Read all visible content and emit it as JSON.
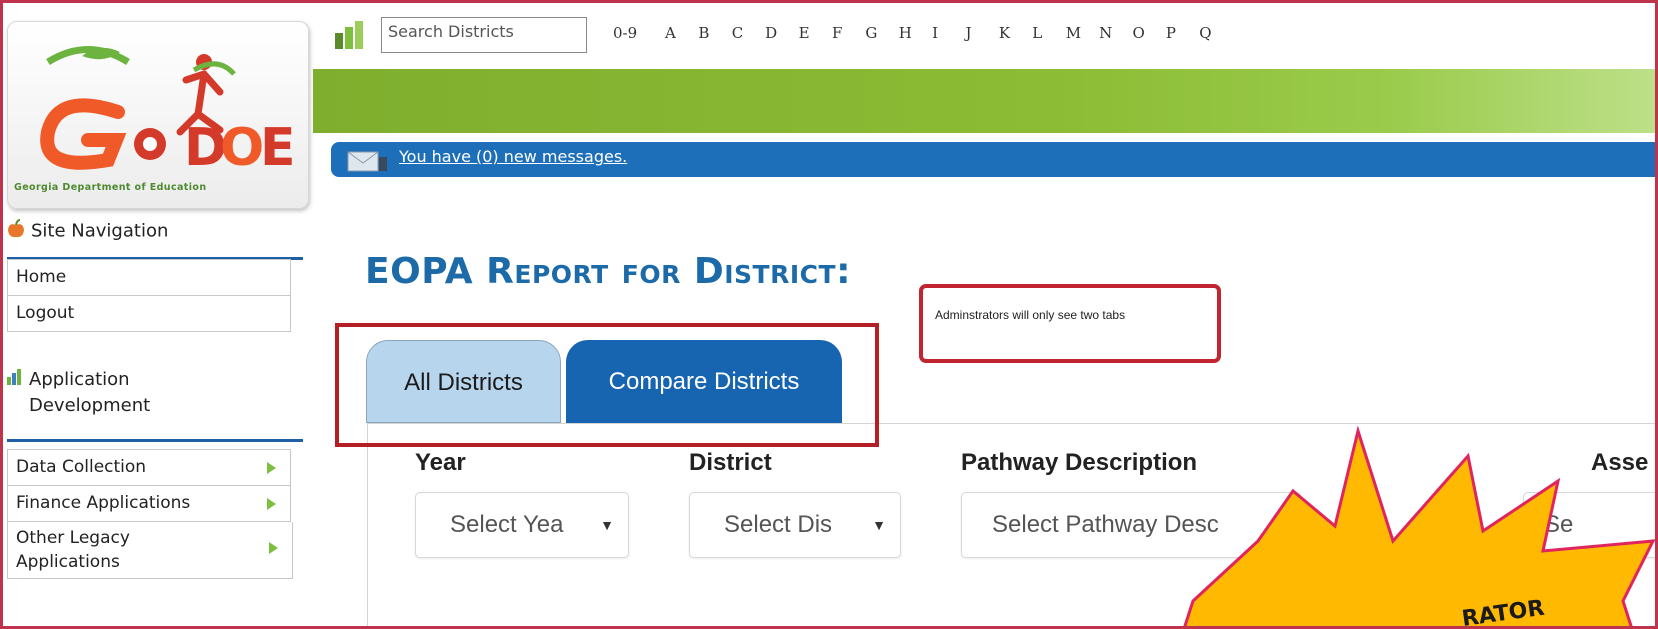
{
  "logo": {
    "text": "GaDOE",
    "tagline": "Georgia Department of Education",
    "colors": {
      "orange": "#f05a28",
      "green": "#6db33f",
      "red": "#d43a2a"
    }
  },
  "sidebar": {
    "site_nav_title": "Site Navigation",
    "site_nav_items": [
      {
        "label": "Home"
      },
      {
        "label": "Logout"
      }
    ],
    "app_dev_title": "Application Development",
    "app_dev_items": [
      {
        "label": "Data Collection",
        "icon": "triangle-right-icon"
      },
      {
        "label": "Finance Applications",
        "icon": "triangle-right-icon"
      },
      {
        "label": "Other Legacy Applications",
        "icon": "triangle-right-icon"
      }
    ]
  },
  "header": {
    "search_placeholder": "Search Districts",
    "alpha_index": [
      "0-9",
      "A",
      "B",
      "C",
      "D",
      "E",
      "F",
      "G",
      "H",
      "I",
      "J",
      "K",
      "L",
      "M",
      "N",
      "O",
      "P",
      "Q"
    ],
    "messages_link": "You have (0) new messages."
  },
  "report": {
    "title": "EOPA Report for District:",
    "note": "Adminstrators will only see two tabs",
    "tabs": [
      {
        "label": "All Districts",
        "active": false
      },
      {
        "label": "Compare Districts",
        "active": true
      }
    ],
    "filters": [
      {
        "label": "Year",
        "value": "Select Yea"
      },
      {
        "label": "District",
        "value": "Select Dis"
      },
      {
        "label": "Pathway Description",
        "value": "Select Pathway Desc"
      },
      {
        "label": "Asse",
        "value": "Se"
      }
    ]
  },
  "burst": {
    "text": "RATOR",
    "fill": "#ffb900",
    "stroke": "#e0245e"
  },
  "colors": {
    "accent_blue": "#1765b0",
    "tab_light": "#b8d5ee",
    "green_bar": "#8cbc35",
    "highlight_red": "#c22530"
  }
}
